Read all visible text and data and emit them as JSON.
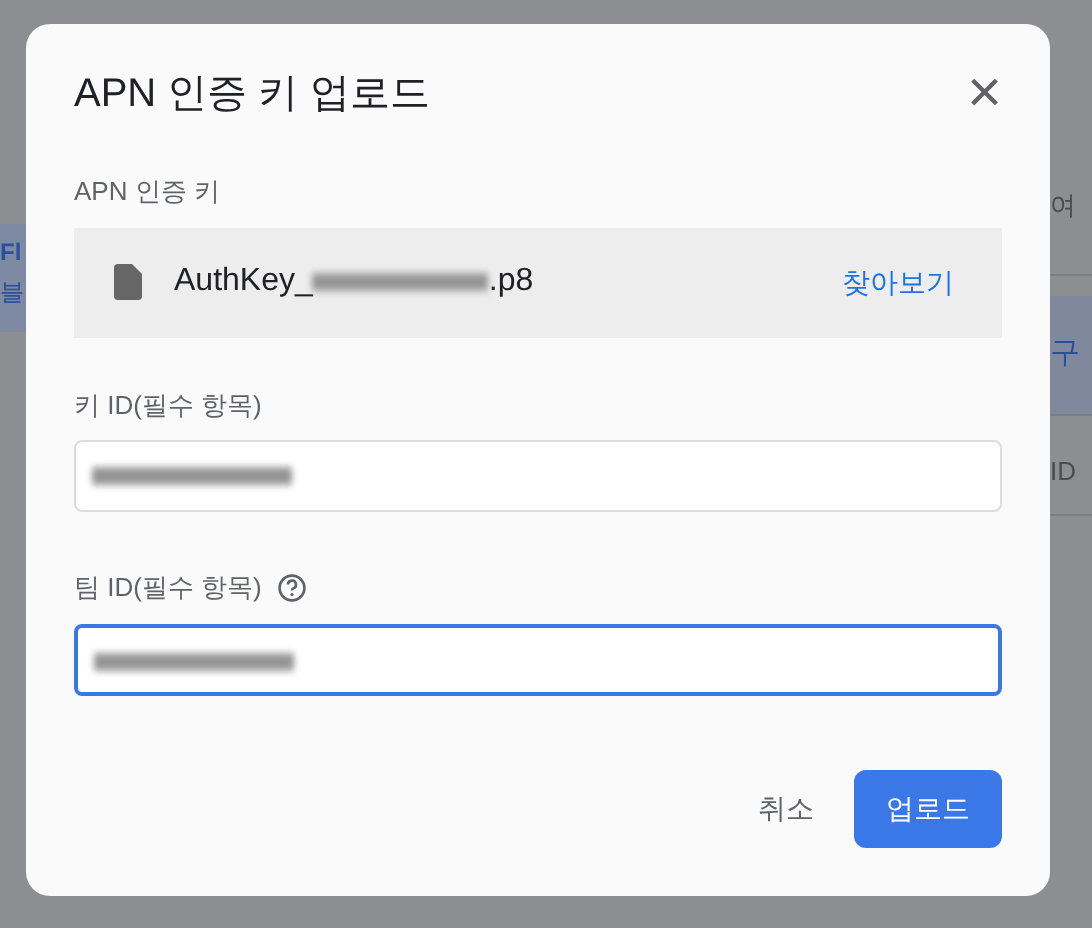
{
  "background": {
    "left_texts": [
      "Fl",
      "블"
    ],
    "right_texts": [
      "여",
      "구",
      "ID"
    ]
  },
  "dialog": {
    "title": "APN 인증 키 업로드",
    "close": "×",
    "file": {
      "label": "APN 인증 키",
      "name_prefix": "AuthKey_",
      "redacted": true,
      "name_suffix": ".p8",
      "browse": "찾아보기"
    },
    "fields": [
      {
        "label": "키 ID(필수 항목)",
        "help": false,
        "redacted": true,
        "focused": false
      },
      {
        "label": "팀 ID(필수 항목)",
        "help": true,
        "redacted": true,
        "focused": true
      }
    ],
    "buttons": [
      {
        "label": "취소",
        "kind": "text"
      },
      {
        "label": "업로드",
        "kind": "primary"
      }
    ]
  }
}
